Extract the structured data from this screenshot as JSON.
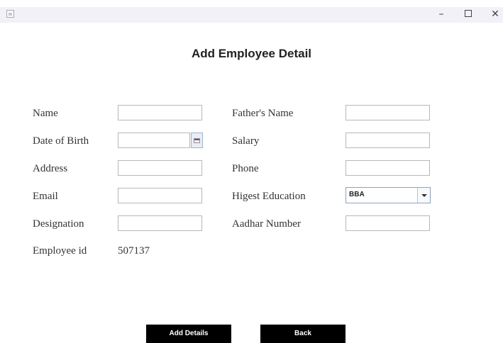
{
  "window": {
    "min_glyph": "–",
    "close_glyph": "✕"
  },
  "heading": "Add Employee Detail",
  "form": {
    "left": [
      {
        "label": "Name",
        "value": ""
      },
      {
        "label": "Date of Birth",
        "value": ""
      },
      {
        "label": "Address",
        "value": ""
      },
      {
        "label": "Email",
        "value": ""
      },
      {
        "label": "Designation",
        "value": ""
      }
    ],
    "right": [
      {
        "label": "Father's Name",
        "value": ""
      },
      {
        "label": "Salary",
        "value": ""
      },
      {
        "label": "Phone",
        "value": ""
      },
      {
        "label": "Higest Education",
        "value": "BBA"
      },
      {
        "label": "Aadhar Number",
        "value": ""
      }
    ],
    "employee_id": {
      "label": "Employee id",
      "value": "507137"
    }
  },
  "buttons": {
    "add": "Add Details",
    "back": "Back"
  },
  "icons": {
    "app": "java-app-icon",
    "calendar": "calendar-icon",
    "dropdown": "chevron-down-icon"
  }
}
